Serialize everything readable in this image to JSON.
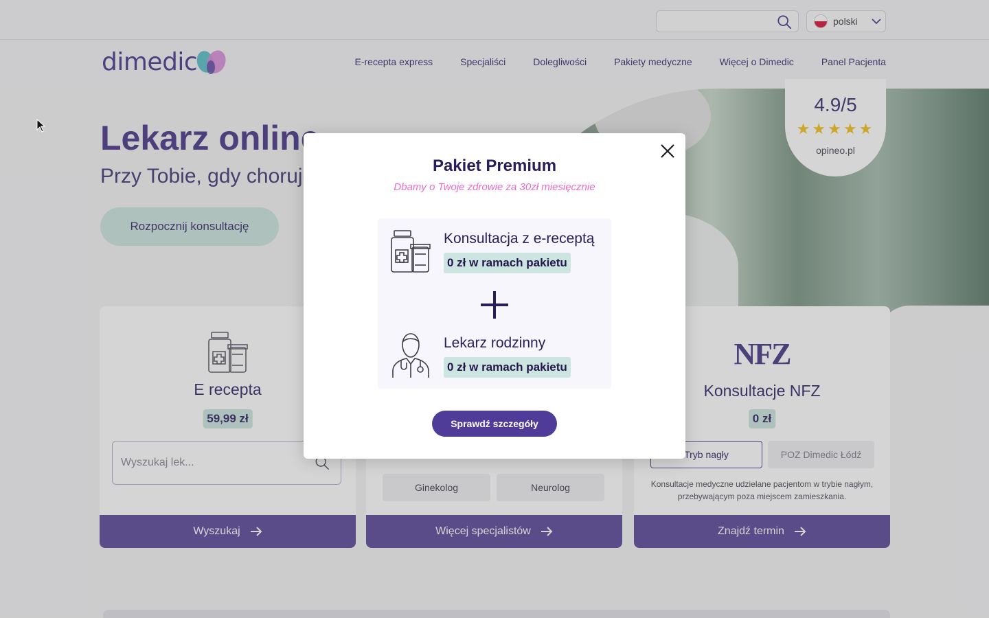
{
  "topbar": {
    "search_placeholder": "",
    "language": "polski"
  },
  "header": {
    "logo": "dimedic",
    "nav": [
      "E-recepta express",
      "Specjaliści",
      "Dolegliwości",
      "Pakiety medyczne",
      "Więcej o Dimedic",
      "Panel Pacjenta"
    ]
  },
  "hero": {
    "title": "Lekarz online",
    "subtitle": "Przy Tobie, gdy chorujesz",
    "button": "Rozpocznij konsultację",
    "rating": {
      "score": "4.9/5",
      "stars": 5,
      "source": "opineo.pl"
    }
  },
  "cards": [
    {
      "title": "E recepta",
      "price": "59,99 zł",
      "search_placeholder": "Wyszukaj lek...",
      "footer": "Wyszukaj"
    },
    {
      "specialists": [
        "Ginekolog",
        "Neurolog"
      ],
      "footer": "Więcej specjalistów"
    },
    {
      "logo": "NFZ",
      "title": "Konsultacje NFZ",
      "price": "0 zł",
      "tabs": [
        "Tryb nagły",
        "POZ Dimedic Łódź"
      ],
      "description": "Konsultacje medyczne udzielane pacjentom w trybie nagłym, przebywającym poza miejscem zamieszkania.",
      "footer": "Znajdź termin"
    }
  ],
  "modal": {
    "title": "Pakiet Premium",
    "subtitle": "Dbamy o Twoje zdrowie za 30zł miesięcznie",
    "items": [
      {
        "title": "Konsultacja z e-receptą",
        "badge": "0 zł w ramach pakietu",
        "icon": "medicine-bottles-icon"
      },
      {
        "title": "Lekarz rodzinny",
        "badge": "0 zł w ramach pakietu",
        "icon": "doctor-icon"
      }
    ],
    "cta": "Sprawdź szczegóły"
  },
  "colors": {
    "brand": "#4f3b98",
    "accent_pink": "#ed6ccb",
    "mint": "#cde5e0",
    "star": "#f3c321"
  }
}
